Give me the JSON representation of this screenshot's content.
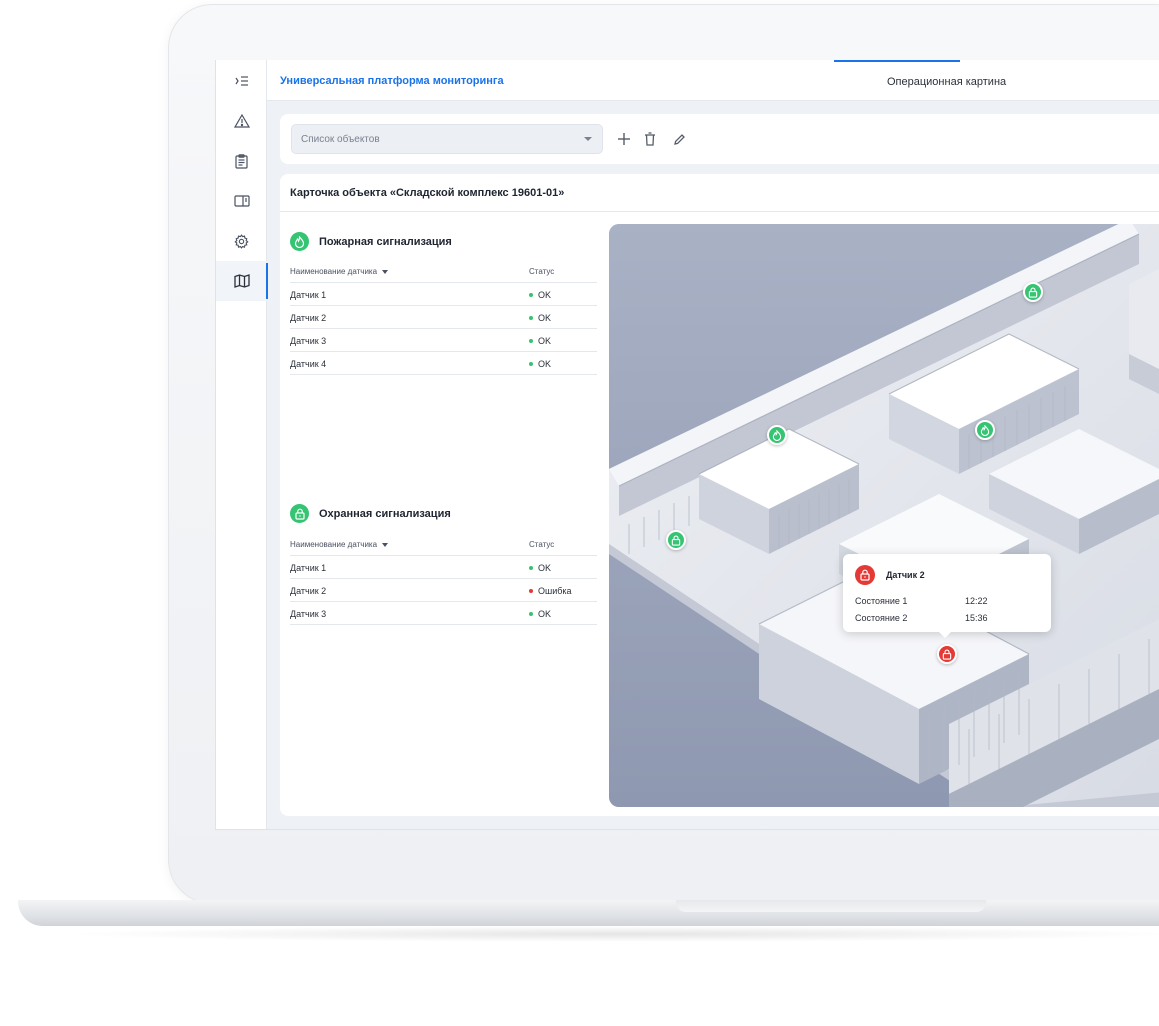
{
  "app": {
    "title": "Универсальная платформа мониторинга",
    "active_tab": "Операционная картина"
  },
  "sidebar": {
    "items": [
      {
        "icon": "menu-collapse-icon"
      },
      {
        "icon": "warning-icon"
      },
      {
        "icon": "clipboard-icon"
      },
      {
        "icon": "panel-icon"
      },
      {
        "icon": "gear-icon"
      },
      {
        "icon": "map-icon",
        "active": true
      }
    ]
  },
  "toolbar": {
    "select_placeholder": "Список объектов",
    "add_icon": "plus-icon",
    "delete_icon": "trash-icon",
    "edit_icon": "pencil-icon"
  },
  "card": {
    "title": "Карточка объекта «Складской комплекс 19601-01»"
  },
  "fire": {
    "title": "Пожарная сигнализация",
    "col_name": "Наименование датчика",
    "col_status": "Статус",
    "rows": [
      {
        "name": "Датчик 1",
        "status": "OK"
      },
      {
        "name": "Датчик 2",
        "status": "OK"
      },
      {
        "name": "Датчик 3",
        "status": "OK"
      },
      {
        "name": "Датчик 4",
        "status": "OK"
      }
    ]
  },
  "security": {
    "title": "Охранная сигнализация",
    "col_name": "Наименование датчика",
    "col_status": "Статус",
    "rows": [
      {
        "name": "Датчик 1",
        "status": "OK"
      },
      {
        "name": "Датчик 2",
        "status": "Ошибка",
        "error": true
      },
      {
        "name": "Датчик 3",
        "status": "OK"
      }
    ]
  },
  "popup": {
    "title": "Датчик 2",
    "rows": [
      {
        "label": "Состояние 1",
        "value": "12:22"
      },
      {
        "label": "Состояние 2",
        "value": "15:36"
      }
    ]
  },
  "colors": {
    "accent": "#1a73e8",
    "ok": "#34c472",
    "error": "#e53935"
  }
}
